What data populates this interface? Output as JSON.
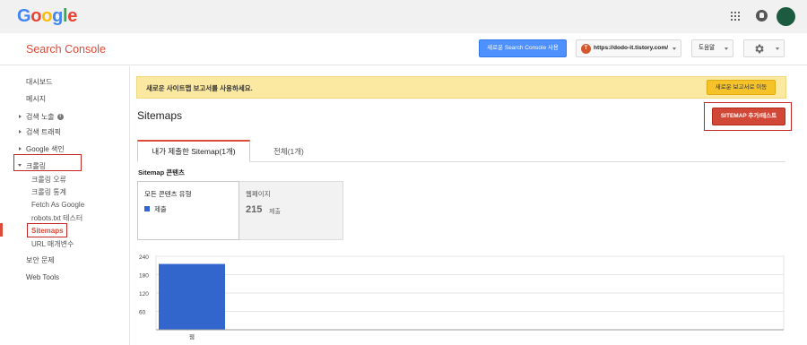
{
  "google_logo": [
    "G",
    "o",
    "o",
    "g",
    "l",
    "e"
  ],
  "google_logo_colors": [
    "#4285f4",
    "#ea4335",
    "#fbbc05",
    "#4285f4",
    "#34a853",
    "#ea4335"
  ],
  "header": {
    "title": "Search Console",
    "try_new_label": "새로운 Search Console 사용",
    "property": "https://dodo-it.tistory.com/",
    "help_label": "도움말"
  },
  "sidebar": {
    "dashboard": "대시보드",
    "messages": "메시지",
    "search_appearance": "검색 노출",
    "search_traffic": "검색 트래픽",
    "google_index": "Google 색인",
    "crawl": "크롤링",
    "crawl_errors": "크롤링 오류",
    "crawl_stats": "크롤링 통계",
    "fetch_as_google": "Fetch As Google",
    "robots_tester": "robots.txt 테스터",
    "sitemaps": "Sitemaps",
    "url_params": "URL 매개변수",
    "security_issues": "보안 문제",
    "web_tools": "Web Tools"
  },
  "notice": {
    "text": "새로운 사이트맵 보고서를 사용하세요.",
    "button": "새로운 보고서로 이동"
  },
  "page": {
    "title": "Sitemaps",
    "add_button": "SITEMAP 추가/테스트"
  },
  "tabs": {
    "submitted": "내가 제출한 Sitemap(1개)",
    "all": "전체(1개)"
  },
  "content": {
    "section_label": "Sitemap 콘텐츠",
    "filter_label": "모든 콘텐츠 유형",
    "legend_submitted": "제출",
    "web_label": "웹페이지",
    "web_count": "215",
    "web_count_label": "제출"
  },
  "colors": {
    "accent_red": "#dd4b39",
    "primary_blue": "#4d90fe",
    "bar_blue": "#3366cc",
    "notice_yellow": "#fbe9a2"
  },
  "chart_data": {
    "type": "bar",
    "categories": [
      "웹"
    ],
    "series": [
      {
        "values": [
          215
        ]
      }
    ],
    "yticks": [
      60,
      120,
      180,
      240
    ],
    "ylim": [
      0,
      240
    ],
    "grid": true
  }
}
